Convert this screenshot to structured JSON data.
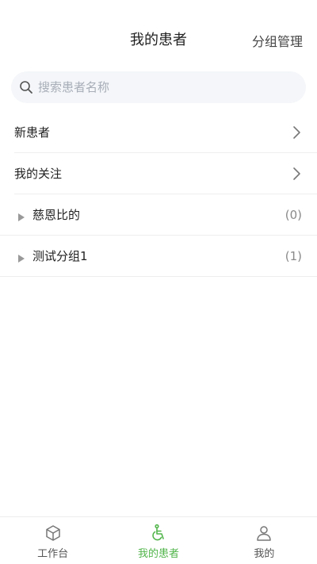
{
  "header": {
    "title": "我的患者",
    "action_label": "分组管理"
  },
  "search": {
    "placeholder": "搜索患者名称",
    "value": ""
  },
  "nav_items": [
    {
      "label": "新患者"
    },
    {
      "label": "我的关注"
    }
  ],
  "groups": [
    {
      "name": "慈恩比的",
      "count": "(0)"
    },
    {
      "name": "测试分组1",
      "count": "(1)"
    }
  ],
  "tabbar": {
    "active": "我的患者",
    "active_color": "#52b54b",
    "tabs": [
      {
        "label": "工作台",
        "icon": "cube-icon"
      },
      {
        "label": "我的患者",
        "icon": "wheelchair-icon"
      },
      {
        "label": "我的",
        "icon": "person-icon"
      }
    ]
  }
}
